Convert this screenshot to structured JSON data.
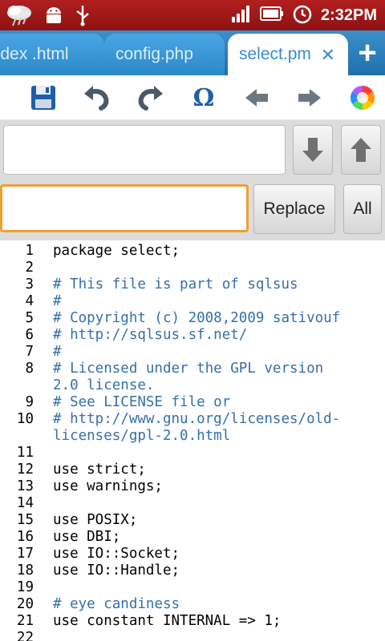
{
  "status_bar": {
    "time": "2:32PM",
    "icons": [
      "weather-icon",
      "android-icon",
      "usb-icon",
      "signal-icon",
      "battery-icon",
      "alarm-icon"
    ]
  },
  "tabs": [
    {
      "label": "index .html",
      "active": false
    },
    {
      "label": "config.php",
      "active": false
    },
    {
      "label": "select.pm",
      "active": true
    }
  ],
  "toolbar": {
    "icons": [
      "save-icon",
      "undo-icon",
      "redo-icon",
      "omega-icon",
      "arrow-left-icon",
      "arrow-right-icon",
      "color-wheel-icon"
    ]
  },
  "search": {
    "find_value": "",
    "replace_value": "",
    "replace_label": "Replace",
    "all_label": "All"
  },
  "code": {
    "lines": [
      {
        "n": "1",
        "text": "package select;",
        "comment": false
      },
      {
        "n": "2",
        "text": "",
        "comment": false
      },
      {
        "n": "3",
        "text": "# This file is part of sqlsus",
        "comment": true
      },
      {
        "n": "4",
        "text": "#",
        "comment": true
      },
      {
        "n": "5",
        "text": "# Copyright (c) 2008,2009 sativouf",
        "comment": true
      },
      {
        "n": "6",
        "text": "# http://sqlsus.sf.net/",
        "comment": true
      },
      {
        "n": "7",
        "text": "#",
        "comment": true
      },
      {
        "n": "8",
        "text": "# Licensed under the GPL version\n2.0 license.",
        "comment": true
      },
      {
        "n": "9",
        "text": "# See LICENSE file or",
        "comment": true
      },
      {
        "n": "10",
        "text": "# http://www.gnu.org/licenses/old-\nlicenses/gpl-2.0.html",
        "comment": true
      },
      {
        "n": "11",
        "text": "",
        "comment": false
      },
      {
        "n": "12",
        "text": "use strict;",
        "comment": false
      },
      {
        "n": "13",
        "text": "use warnings;",
        "comment": false
      },
      {
        "n": "14",
        "text": "",
        "comment": false
      },
      {
        "n": "15",
        "text": "use POSIX;",
        "comment": false
      },
      {
        "n": "16",
        "text": "use DBI;",
        "comment": false
      },
      {
        "n": "17",
        "text": "use IO::Socket;",
        "comment": false
      },
      {
        "n": "18",
        "text": "use IO::Handle;",
        "comment": false
      },
      {
        "n": "19",
        "text": "",
        "comment": false
      },
      {
        "n": "20",
        "text": "# eye candiness",
        "comment": true
      },
      {
        "n": "21",
        "text": "use constant INTERNAL => 1;",
        "comment": false
      },
      {
        "n": "22",
        "text": "",
        "comment": false
      }
    ]
  }
}
